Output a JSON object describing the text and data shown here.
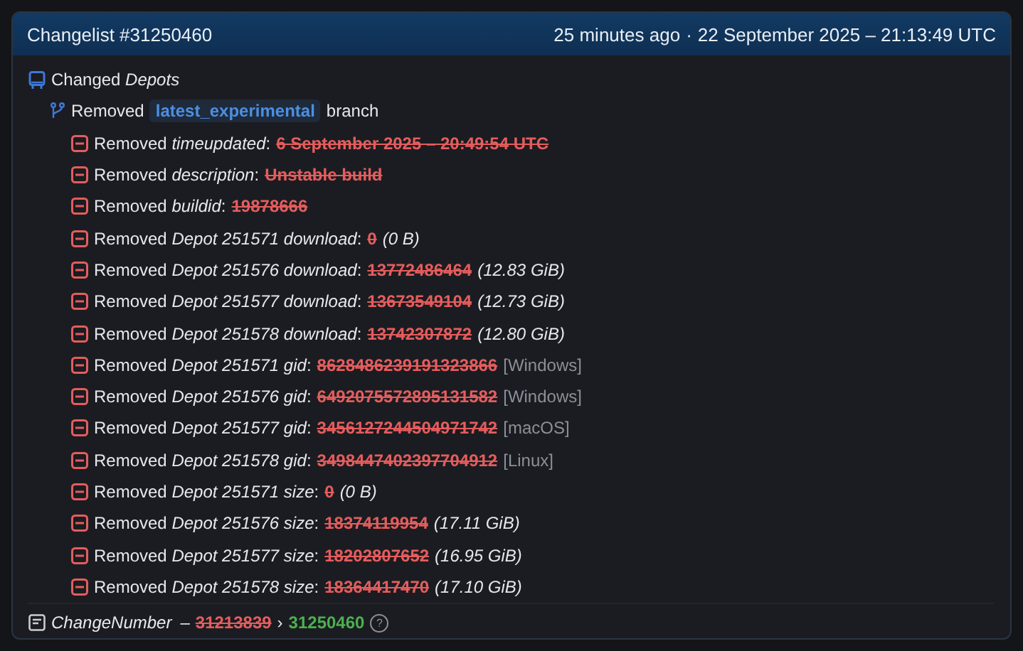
{
  "header": {
    "title": "Changelist #31250460",
    "time_ago": "25 minutes ago",
    "separator": "·",
    "date": "22 September 2025 – 21:13:49 UTC"
  },
  "section": {
    "label": "Changed *Depots*",
    "branch": {
      "prefix": "Removed",
      "name": "latest_experimental",
      "suffix": "branch"
    },
    "changes": [
      {
        "label": "Removed *timeupdated*:",
        "old": "6 September 2025 – 20:49:54 UTC"
      },
      {
        "label": "Removed *description*:",
        "old": "Unstable build"
      },
      {
        "label": "Removed *buildid*:",
        "old": "19878666"
      },
      {
        "label": "Removed *Depot 251571 download*:",
        "old": "0",
        "note": "(0 B)",
        "kind": "size"
      },
      {
        "label": "Removed *Depot 251576 download*:",
        "old": "13772486464",
        "note": "(12.83 GiB)",
        "kind": "size"
      },
      {
        "label": "Removed *Depot 251577 download*:",
        "old": "13673549104",
        "note": "(12.73 GiB)",
        "kind": "size"
      },
      {
        "label": "Removed *Depot 251578 download*:",
        "old": "13742307872",
        "note": "(12.80 GiB)",
        "kind": "size"
      },
      {
        "label": "Removed *Depot 251571 gid*:",
        "old": "8628486239191323866",
        "note": "[Windows]",
        "kind": "platform"
      },
      {
        "label": "Removed *Depot 251576 gid*:",
        "old": "6492075572895131582",
        "note": "[Windows]",
        "kind": "platform"
      },
      {
        "label": "Removed *Depot 251577 gid*:",
        "old": "3456127244504971742",
        "note": "[macOS]",
        "kind": "platform"
      },
      {
        "label": "Removed *Depot 251578 gid*:",
        "old": "3498447402397704912",
        "note": "[Linux]",
        "kind": "platform"
      },
      {
        "label": "Removed *Depot 251571 size*:",
        "old": "0",
        "note": "(0 B)",
        "kind": "size"
      },
      {
        "label": "Removed *Depot 251576 size*:",
        "old": "18374119954",
        "note": "(17.11 GiB)",
        "kind": "size"
      },
      {
        "label": "Removed *Depot 251577 size*:",
        "old": "18202807652",
        "note": "(16.95 GiB)",
        "kind": "size"
      },
      {
        "label": "Removed *Depot 251578 size*:",
        "old": "18364417470",
        "note": "(17.10 GiB)",
        "kind": "size"
      }
    ]
  },
  "footer": {
    "label": "ChangeNumber",
    "dash": "–",
    "old": "31213839",
    "arrow": "›",
    "new": "31250460",
    "help": "?"
  }
}
